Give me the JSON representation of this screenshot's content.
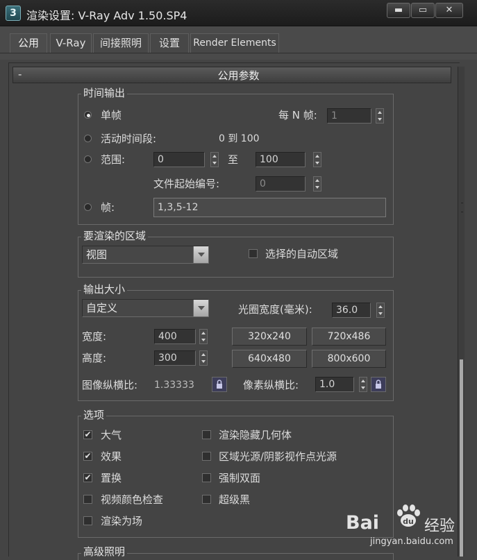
{
  "window": {
    "title": "渲染设置: V-Ray Adv 1.50.SP4",
    "app_icon": "3ds-max-logo-icon",
    "controls": {
      "minimize": "▬",
      "maximize": "▭",
      "close": "✕"
    }
  },
  "tabs": [
    {
      "label": "公用",
      "active": true
    },
    {
      "label": "V-Ray",
      "active": false
    },
    {
      "label": "间接照明",
      "active": false
    },
    {
      "label": "设置",
      "active": false
    },
    {
      "label": "Render Elements",
      "active": false
    }
  ],
  "rollout": {
    "collapse": "-",
    "title": "公用参数"
  },
  "time_output": {
    "label": "时间输出",
    "single": "单帧",
    "every_n_label": "每 N 帧:",
    "every_n_value": "1",
    "active_segment": "活动时间段:",
    "active_range": "0 到 100",
    "range_label": "范围:",
    "range_from": "0",
    "range_to_label": "至",
    "range_to": "100",
    "file_start_label": "文件起始编号:",
    "file_start_value": "0",
    "frames_label": "帧:",
    "frames_value": "1,3,5-12"
  },
  "render_area": {
    "label": "要渲染的区域",
    "selected": "视图",
    "auto_region": "选择的自动区域"
  },
  "output_size": {
    "label": "输出大小",
    "preset": "自定义",
    "aperture_label": "光圈宽度(毫米):",
    "aperture_value": "36.0",
    "width_label": "宽度:",
    "width_value": "400",
    "height_label": "高度:",
    "height_value": "300",
    "presets": [
      "320x240",
      "720x486",
      "640x480",
      "800x600"
    ],
    "image_aspect_label": "图像纵横比:",
    "image_aspect_value": "1.33333",
    "pixel_aspect_label": "像素纵横比:",
    "pixel_aspect_value": "1.0"
  },
  "options": {
    "label": "选项",
    "left": [
      {
        "label": "大气",
        "checked": true
      },
      {
        "label": "效果",
        "checked": true
      },
      {
        "label": "置换",
        "checked": true
      },
      {
        "label": "视频颜色检查",
        "checked": false
      },
      {
        "label": "渲染为场",
        "checked": false
      }
    ],
    "right": [
      {
        "label": "渲染隐藏几何体",
        "checked": false
      },
      {
        "label": "区域光源/阴影视作点光源",
        "checked": false
      },
      {
        "label": "强制双面",
        "checked": false
      },
      {
        "label": "超级黑",
        "checked": false
      }
    ],
    "check_mark": "✔"
  },
  "advanced_lighting": {
    "label": "高级照明"
  },
  "watermark": {
    "logo": "Bai",
    "logo2": "du",
    "cn": "经验",
    "url": "jingyan.baidu.com"
  }
}
